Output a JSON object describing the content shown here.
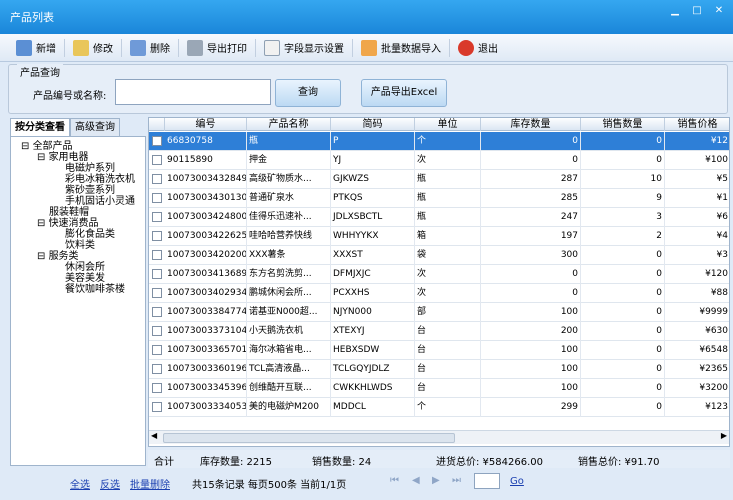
{
  "window": {
    "title": "产品列表"
  },
  "toolbar": {
    "add": "新增",
    "edit": "修改",
    "delete": "删除",
    "export_print": "导出打印",
    "field_settings": "字段显示设置",
    "bulk_import": "批量数据导入",
    "exit": "退出"
  },
  "query": {
    "legend": "产品查询",
    "label": "产品编号或名称:",
    "value": "",
    "search_btn": "查询",
    "export_btn": "产品导出Excel"
  },
  "tabs": [
    "按分类查看",
    "高级查询"
  ],
  "tree": [
    "全部产品",
    "家用电器",
    "电磁炉系列",
    "彩电冰箱洗衣机",
    "紫砂壶系列",
    "手机固话小灵通",
    "服装鞋帽",
    "快速消费品",
    "膨化食品类",
    "饮料类",
    "服务类",
    "休闲会所",
    "美容美发",
    "餐饮咖啡茶楼"
  ],
  "columns": [
    "编号",
    "产品名称",
    "简码",
    "单位",
    "库存数量",
    "销售数量",
    "销售价格"
  ],
  "rows": [
    [
      "66830758",
      "瓶",
      "P",
      "个",
      "0",
      "0",
      "¥12"
    ],
    [
      "90115890",
      "押金",
      "YJ",
      "次",
      "0",
      "0",
      "¥100"
    ],
    [
      "10073003432849",
      "高级矿物质水...",
      "GJKWZS",
      "瓶",
      "287",
      "10",
      "¥5"
    ],
    [
      "10073003430130",
      "普通矿泉水",
      "PTKQS",
      "瓶",
      "285",
      "9",
      "¥1"
    ],
    [
      "10073003424800",
      "佳得乐迅速补...",
      "JDLXSBCTL",
      "瓶",
      "247",
      "3",
      "¥6"
    ],
    [
      "10073003422625",
      "哇哈哈营养快线",
      "WHHYYKX",
      "箱",
      "197",
      "2",
      "¥4"
    ],
    [
      "10073003420200",
      "XXX薯条",
      "XXXST",
      "袋",
      "300",
      "0",
      "¥3"
    ],
    [
      "10073003413689",
      "东方名剪洗剪...",
      "DFMJXJC",
      "次",
      "0",
      "0",
      "¥120"
    ],
    [
      "10073003402934",
      "鹏城休闲会所...",
      "PCXXHS",
      "次",
      "0",
      "0",
      "¥88"
    ],
    [
      "10073003384774",
      "诺基亚N000超...",
      "NJYN000",
      "部",
      "100",
      "0",
      "¥9999"
    ],
    [
      "10073003373104",
      "小天鹅洗衣机",
      "XTEXYJ",
      "台",
      "200",
      "0",
      "¥630"
    ],
    [
      "10073003365701",
      "海尔冰箱省电...",
      "HEBXSDW",
      "台",
      "100",
      "0",
      "¥6548"
    ],
    [
      "10073003360196",
      "TCL高清液晶...",
      "TCLGQYJDLZ",
      "台",
      "100",
      "0",
      "¥2365"
    ],
    [
      "10073003345396",
      "创维酷开互联...",
      "CWKKHLWDS",
      "台",
      "100",
      "0",
      "¥3200"
    ],
    [
      "10073003334053",
      "美的电磁炉M200",
      "MDDCL",
      "个",
      "299",
      "0",
      "¥123"
    ]
  ],
  "summary": {
    "total": "合计",
    "stock": "库存数量: 2215",
    "sales": "销售数量: 24",
    "purchase": "进货总价: ¥584266.00",
    "sales_total": "销售总价: ¥91.70"
  },
  "footer": {
    "select_all": "全选",
    "invert": "反选",
    "bulk_delete": "批量删除",
    "paging": "共15条记录 每页500条 当前1/1页",
    "go": "Go"
  },
  "colors": {
    "title": "#1a86d9",
    "selected": "#2e7fd7"
  }
}
